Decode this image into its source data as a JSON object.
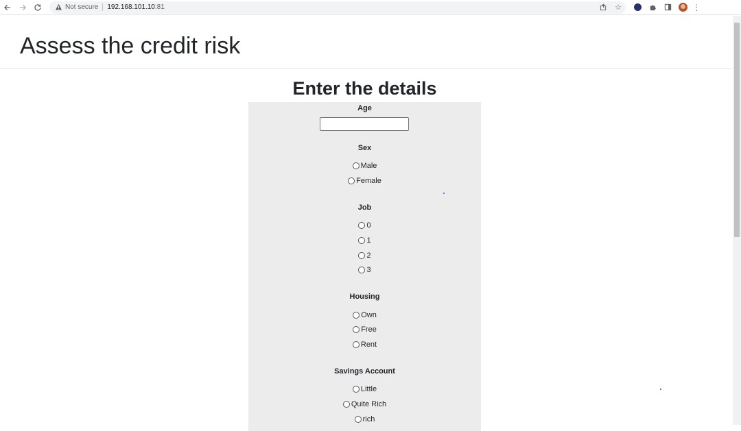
{
  "browser": {
    "security_label": "Not secure",
    "url_host": "192.168.101.10",
    "url_port": ":81"
  },
  "header": {
    "title": "Assess the credit risk"
  },
  "form": {
    "heading": "Enter the details",
    "age": {
      "label": "Age",
      "value": ""
    },
    "sex": {
      "label": "Sex",
      "options": [
        "Male",
        "Female"
      ]
    },
    "job": {
      "label": "Job",
      "options": [
        "0",
        "1",
        "2",
        "3"
      ]
    },
    "housing": {
      "label": "Housing",
      "options": [
        "Own",
        "Free",
        "Rent"
      ]
    },
    "savings": {
      "label": "Savings Account",
      "options": [
        "Little",
        "Quite Rich",
        "rich"
      ]
    }
  },
  "colors": {
    "panel": "#ececec",
    "text": "#212529"
  }
}
